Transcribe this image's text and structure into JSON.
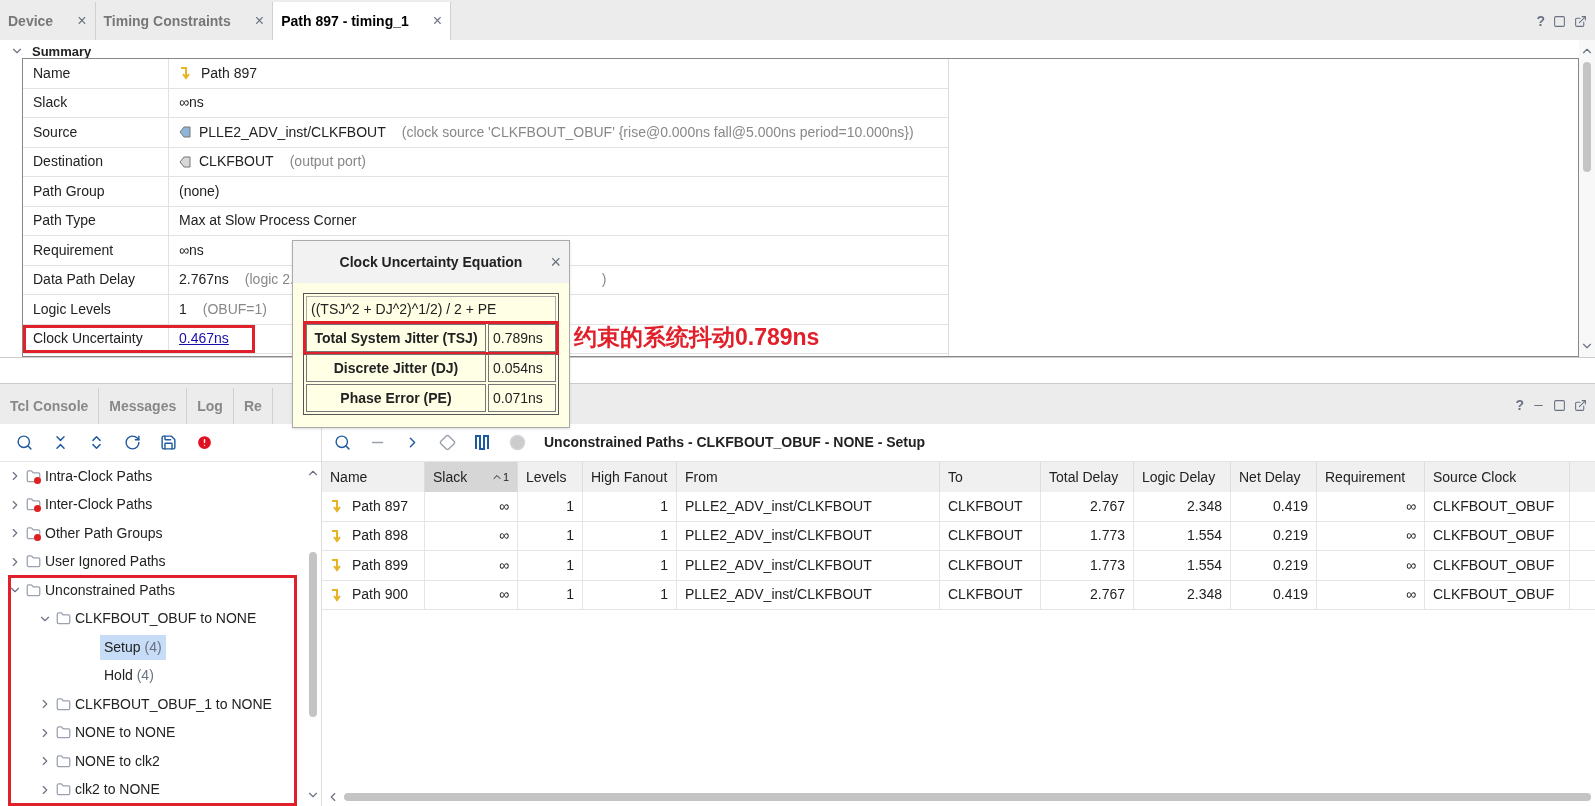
{
  "top_tabs": [
    {
      "label": "Device",
      "selected": false,
      "close": "×"
    },
    {
      "label": "Timing Constraints",
      "selected": false,
      "close": "×"
    },
    {
      "label": "Path 897 - timing_1",
      "selected": true,
      "close": "×"
    }
  ],
  "top_controls": [
    "?"
  ],
  "summary": {
    "title": "Summary",
    "rows": [
      {
        "label": "Name",
        "value": "Path 897",
        "kind": "path"
      },
      {
        "label": "Slack",
        "value": "∞ns"
      },
      {
        "label": "Source",
        "value": "PLLE2_ADV_inst/CLKFBOUT",
        "kind": "source_port",
        "detail": "(clock source 'CLKFBOUT_OBUF'  {rise@0.000ns fall@5.000ns period=10.000ns})"
      },
      {
        "label": "Destination",
        "value": "CLKFBOUT",
        "kind": "output_port",
        "detail": "(output port)"
      },
      {
        "label": "Path Group",
        "value": "(none)"
      },
      {
        "label": "Path Type",
        "value": "Max at Slow Process Corner"
      },
      {
        "label": "Requirement",
        "value": "∞ns"
      },
      {
        "label": "Data Path Delay",
        "value": "2.767ns",
        "detail": "(logic 2.",
        "detail_tail": ")"
      },
      {
        "label": "Logic Levels",
        "value": "1",
        "detail": "(OBUF=1)"
      },
      {
        "label": "Clock Uncertainty",
        "value": "0.467ns",
        "link": true,
        "highlighted": true
      }
    ]
  },
  "popup": {
    "title": "Clock Uncertainty Equation",
    "close": "×",
    "equation": "((TSJ^2 + DJ^2)^1/2) / 2 + PE",
    "rows": [
      {
        "label": "Total System Jitter (TSJ)",
        "value": "0.789ns",
        "highlighted": true
      },
      {
        "label": "Discrete Jitter (DJ)",
        "value": "0.054ns",
        "highlighted": false
      },
      {
        "label": "Phase Error (PE)",
        "value": "0.071ns",
        "highlighted": false
      }
    ]
  },
  "annotation": "约束的系统抖动0.789ns",
  "bottom_tabs": [
    {
      "label": "Tcl Console",
      "selected": false
    },
    {
      "label": "Messages",
      "selected": false
    },
    {
      "label": "Log",
      "selected": false
    },
    {
      "label": "Re",
      "selected": false
    }
  ],
  "bottom_controls": [
    "?"
  ],
  "tree": {
    "highlighted": true,
    "items": [
      {
        "label": "Intra-Clock Paths",
        "expanded": false,
        "warning": true
      },
      {
        "label": "Inter-Clock Paths",
        "expanded": false,
        "warning": true
      },
      {
        "label": "Other Path Groups",
        "expanded": false,
        "warning": true
      },
      {
        "label": "User Ignored Paths",
        "expanded": false,
        "warning": false
      },
      {
        "label": "Unconstrained Paths",
        "expanded": true,
        "warning": false,
        "children": [
          {
            "label": "CLKFBOUT_OBUF to NONE",
            "expanded": true,
            "warning": false,
            "children": [
              {
                "kind": "leaf",
                "label": "Setup",
                "count": "(4)",
                "selected": true
              },
              {
                "kind": "leaf",
                "label": "Hold",
                "count": "(4)",
                "selected": false
              }
            ]
          },
          {
            "label": "CLKFBOUT_OBUF_1 to NONE",
            "expanded": false,
            "warning": false
          },
          {
            "label": "NONE to NONE",
            "expanded": false,
            "warning": false
          },
          {
            "label": "NONE to clk2",
            "expanded": false,
            "warning": false
          },
          {
            "label": "clk2 to NONE",
            "expanded": false,
            "warning": false
          }
        ]
      }
    ]
  },
  "results": {
    "title": "Unconstrained Paths - CLKFBOUT_OBUF - NONE - Setup",
    "columns": [
      {
        "label": "Name",
        "sorted": false
      },
      {
        "label": "Slack",
        "sorted": true,
        "sort_index": "1"
      },
      {
        "label": "Levels",
        "sorted": false
      },
      {
        "label": "High Fanout",
        "sorted": false
      },
      {
        "label": "From",
        "sorted": false
      },
      {
        "label": "To",
        "sorted": false
      },
      {
        "label": "Total Delay",
        "sorted": false
      },
      {
        "label": "Logic Delay",
        "sorted": false
      },
      {
        "label": "Net Delay",
        "sorted": false
      },
      {
        "label": "Requirement",
        "sorted": false
      },
      {
        "label": "Source Clock",
        "sorted": false
      }
    ],
    "rows": [
      [
        "Path 897",
        "∞",
        "1",
        "1",
        "PLLE2_ADV_inst/CLKFBOUT",
        "CLKFBOUT",
        "2.767",
        "2.348",
        "0.419",
        "∞",
        "CLKFBOUT_OBUF"
      ],
      [
        "Path 898",
        "∞",
        "1",
        "1",
        "PLLE2_ADV_inst/CLKFBOUT",
        "CLKFBOUT",
        "1.773",
        "1.554",
        "0.219",
        "∞",
        "CLKFBOUT_OBUF"
      ],
      [
        "Path 899",
        "∞",
        "1",
        "1",
        "PLLE2_ADV_inst/CLKFBOUT",
        "CLKFBOUT",
        "1.773",
        "1.554",
        "0.219",
        "∞",
        "CLKFBOUT_OBUF"
      ],
      [
        "Path 900",
        "∞",
        "1",
        "1",
        "PLLE2_ADV_inst/CLKFBOUT",
        "CLKFBOUT",
        "2.767",
        "2.348",
        "0.419",
        "∞",
        "CLKFBOUT_OBUF"
      ]
    ]
  }
}
